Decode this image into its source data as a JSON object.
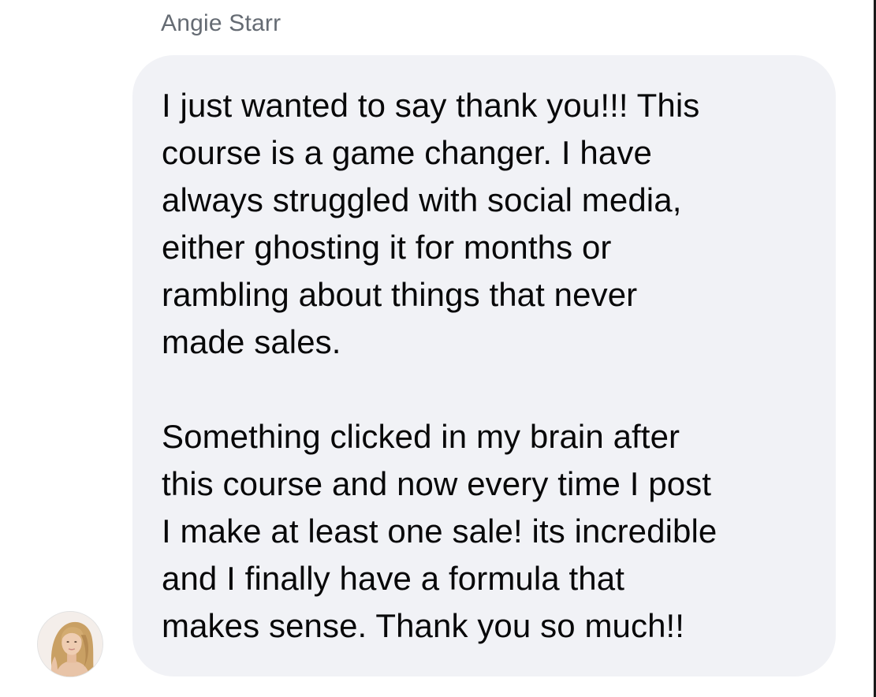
{
  "message": {
    "sender_name": "Angie Starr",
    "paragraphs": [
      "I just wanted to say thank you!!! This\ncourse is a game changer. I have\nalways struggled with social media,\neither ghosting it for months or\nrambling about things that never\nmade sales.",
      "Something clicked in my brain after\nthis course and now every time I post\nI make at least one sale! its incredible\nand I finally have a formula that\nmakes sense. Thank you so much!!"
    ],
    "avatar_icon": "profile-photo",
    "bubble_color": "#f1f2f6",
    "text_color": "#080809",
    "name_color": "#656b73"
  }
}
